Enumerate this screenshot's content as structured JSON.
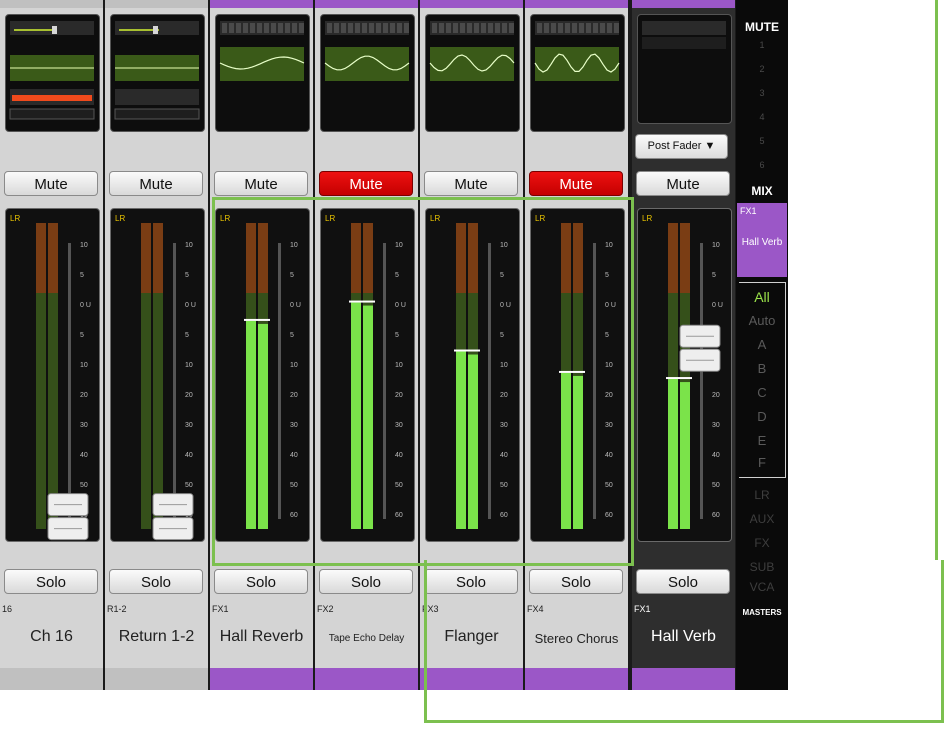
{
  "strips": [
    {
      "id": "ch16",
      "mute": "Mute",
      "muted": false,
      "solo": "Solo",
      "tag": "16",
      "name": "Ch 16",
      "fader": 0.07,
      "meter": 0.0
    },
    {
      "id": "ret12",
      "mute": "Mute",
      "muted": false,
      "solo": "Solo",
      "tag": "R1-2",
      "name": "Return 1-2",
      "fader": 0.07,
      "meter": 0.0
    },
    {
      "id": "fx1",
      "mute": "Mute",
      "muted": false,
      "solo": "Solo",
      "tag": "FX1",
      "name": "Hall Reverb",
      "fader": 0.0,
      "meter": 0.68
    },
    {
      "id": "fx2",
      "mute": "Mute",
      "muted": true,
      "solo": "Solo",
      "tag": "FX2",
      "name": "Tape Echo Delay",
      "fader": 0.0,
      "meter": 0.74
    },
    {
      "id": "fx3",
      "mute": "Mute",
      "muted": false,
      "solo": "Solo",
      "tag": "FX3",
      "name": "Flanger",
      "fader": 0.0,
      "meter": 0.58
    },
    {
      "id": "fx4",
      "mute": "Mute",
      "muted": true,
      "solo": "Solo",
      "tag": "FX4",
      "name": "Stereo Chorus",
      "fader": 0.0,
      "meter": 0.51
    },
    {
      "id": "master",
      "mute": "Mute",
      "muted": false,
      "solo": "Solo",
      "tag": "FX1",
      "name": "Hall Verb",
      "fader": 0.62,
      "meter": 0.49,
      "post_fader": "Post Fader"
    }
  ],
  "meter_labels": {
    "lr": "LR",
    "scale": [
      "10",
      "5",
      "0 U",
      "5",
      "10",
      "20",
      "30",
      "40",
      "50",
      "60"
    ]
  },
  "sidebar": {
    "mute_title": "MUTE",
    "mute_groups": [
      "1",
      "2",
      "3",
      "4",
      "5",
      "6"
    ],
    "mix_title": "MIX",
    "fx_tag": "FX1",
    "fx_name": "Hall Verb",
    "groups": [
      "All",
      "Auto",
      "A",
      "B",
      "C",
      "D",
      "E",
      "F"
    ],
    "masters_items": [
      "LR",
      "AUX",
      "FX",
      "SUB",
      "VCA"
    ],
    "masters_title": "MASTERS"
  },
  "colors": {
    "mute_active": "#e00000",
    "purple": "#9b57c7",
    "meter_green": "#7be34a",
    "highlight": "#7cc04f"
  }
}
